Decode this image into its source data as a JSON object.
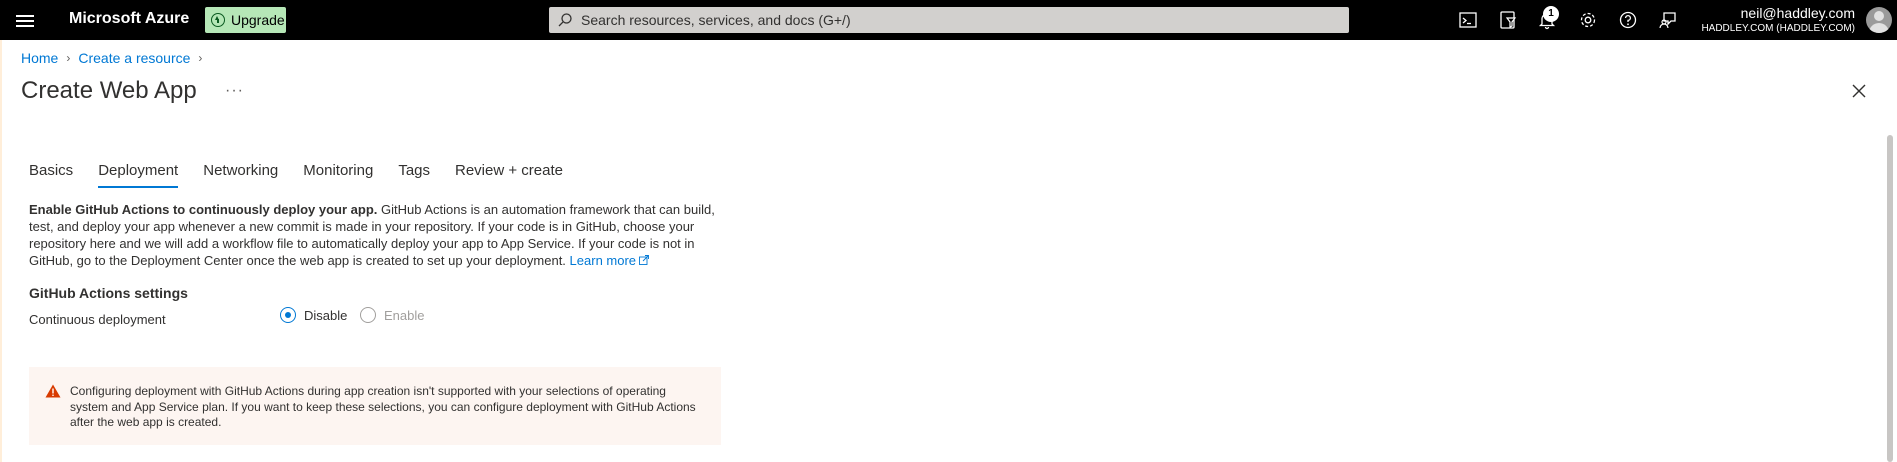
{
  "topbar": {
    "brand": "Microsoft Azure",
    "upgrade_label": "Upgrade",
    "search_placeholder": "Search resources, services, and docs (G+/)",
    "notification_count": "1",
    "user_email": "neil@haddley.com",
    "user_tenant": "HADDLEY.COM (HADDLEY.COM)",
    "icons": [
      "menu-icon",
      "cloud-shell-icon",
      "directory-filter-icon",
      "notifications-icon",
      "settings-icon",
      "help-icon",
      "feedback-icon"
    ]
  },
  "breadcrumb": {
    "items": [
      "Home",
      "Create a resource"
    ]
  },
  "page": {
    "title": "Create Web App",
    "more_label": "···"
  },
  "tabs": [
    {
      "label": "Basics",
      "active": false
    },
    {
      "label": "Deployment",
      "active": true
    },
    {
      "label": "Networking",
      "active": false
    },
    {
      "label": "Monitoring",
      "active": false
    },
    {
      "label": "Tags",
      "active": false
    },
    {
      "label": "Review + create",
      "active": false
    }
  ],
  "intro": {
    "bold": "Enable GitHub Actions to continuously deploy your app.",
    "text": " GitHub Actions is an automation framework that can build, test, and deploy your app whenever a new commit is made in your repository. If your code is in GitHub, choose your repository here and we will add a workflow file to automatically deploy your app to App Service. If your code is not in GitHub, go to the Deployment Center once the web app is created to set up your deployment. ",
    "link": "Learn more"
  },
  "github_settings": {
    "section_title": "GitHub Actions settings",
    "field_label": "Continuous deployment",
    "options": [
      {
        "label": "Disable",
        "selected": true,
        "enabled": true
      },
      {
        "label": "Enable",
        "selected": false,
        "enabled": false
      }
    ]
  },
  "warning": {
    "text": "Configuring deployment with GitHub Actions during app creation isn't supported with your selections of operating system and App Service plan. If you want to keep these selections, you can configure deployment with GitHub Actions after the web app is created."
  },
  "colors": {
    "accent": "#0078d4",
    "topbar": "#000000",
    "upgrade": "#b6e7b7",
    "warning_bg": "#fdf5f1",
    "warning_icon": "#d83b01"
  }
}
